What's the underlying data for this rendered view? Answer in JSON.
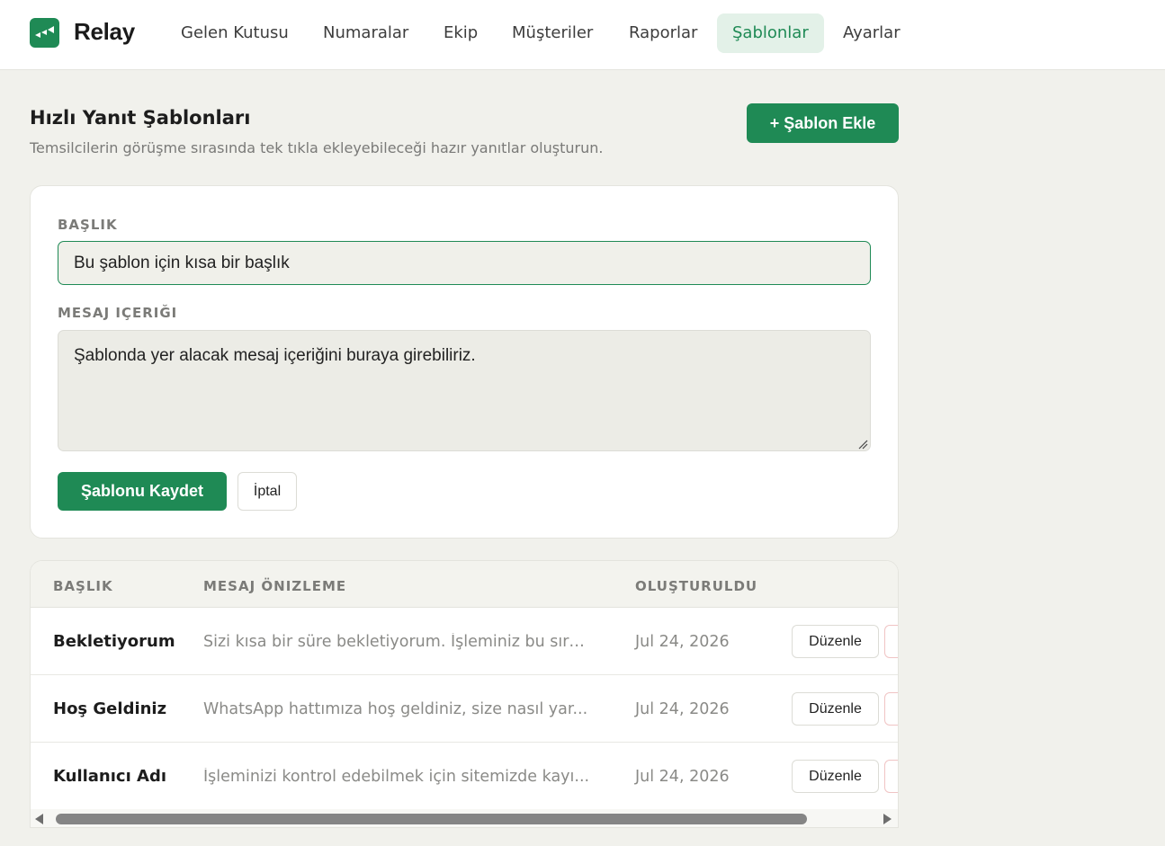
{
  "app": {
    "name": "Relay",
    "brand_color": "#1f8a55"
  },
  "nav": {
    "items": [
      {
        "label": "Gelen Kutusu"
      },
      {
        "label": "Numaralar"
      },
      {
        "label": "Ekip"
      },
      {
        "label": "Müşteriler"
      },
      {
        "label": "Raporlar"
      },
      {
        "label": "Şablonlar",
        "active": true
      },
      {
        "label": "Ayarlar"
      }
    ]
  },
  "page": {
    "title": "Hızlı Yanıt Şablonları",
    "subtitle": "Temsilcilerin görüşme sırasında tek tıkla ekleyebileceği hazır yanıtlar oluşturun.",
    "add_button": "+ Şablon Ekle"
  },
  "form": {
    "title_label": "BAŞLIK",
    "title_value": "Bu şablon için kısa bir başlık",
    "message_label": "MESAJ IÇERIĞI",
    "message_value": "Şablonda yer alacak mesaj içeriğini buraya girebiliriz.",
    "save_button": "Şablonu Kaydet",
    "cancel_button": "İptal"
  },
  "table": {
    "headers": [
      "BAŞLIK",
      "MESAJ ÖNIZLEME",
      "OLUŞTURULDU"
    ],
    "edit_label": "Düzenle",
    "rows": [
      {
        "title": "Bekletiyorum",
        "preview": "Sizi kısa bir süre bekletiyorum. İşleminiz bu sıra...",
        "date": "Jul 24, 2026"
      },
      {
        "title": "Hoş Geldiniz",
        "preview": "WhatsApp hattımıza hoş geldiniz, size nasıl yar...",
        "date": "Jul 24, 2026"
      },
      {
        "title": "Kullanıcı Adı",
        "preview": "İşleminizi kontrol edebilmek için sitemizde kayı...",
        "date": "Jul 24, 2026"
      }
    ]
  }
}
